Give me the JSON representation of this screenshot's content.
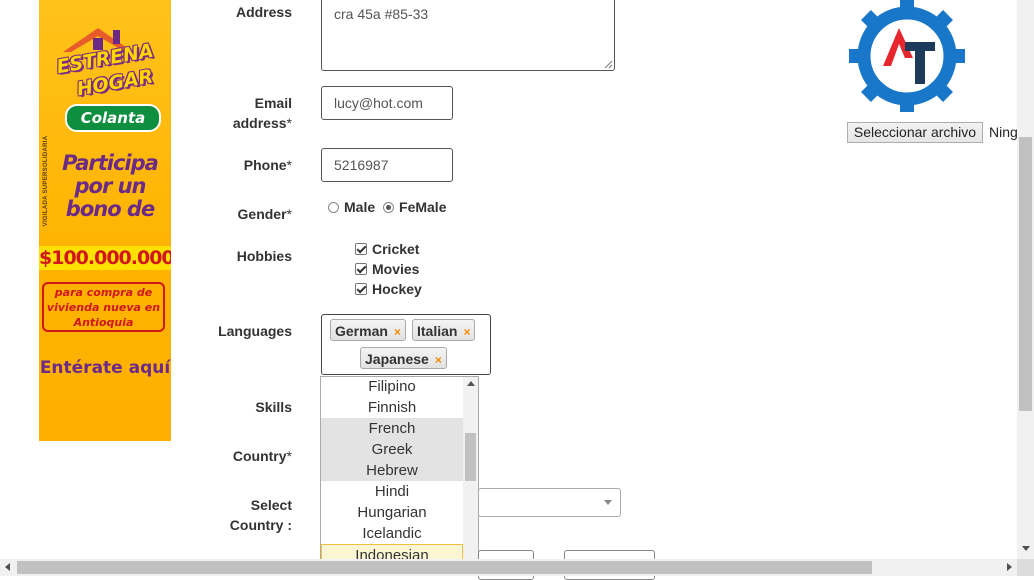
{
  "ad": {
    "brand_line1": "ESTRENA",
    "brand_line2": "HOGAR",
    "brand_logo": "Colanta",
    "side_text": "VIGILADA SUPERSOLIDARIA",
    "headline": "Participa por un bono de",
    "amount": "$100.000.000",
    "detail": "para compra de vivienda nueva en Antioquia",
    "cta": "Entérate aquí",
    "colors": {
      "background": "#ffb300",
      "purple": "#6b2a86",
      "red": "#d1161c",
      "green": "#0d8f3f"
    }
  },
  "form": {
    "address": {
      "label": "Address",
      "value": "cra 45a #85-33"
    },
    "email": {
      "label": "Email address",
      "required_mark": "*",
      "value": "lucy@hot.com"
    },
    "phone": {
      "label": "Phone",
      "required_mark": "*",
      "value": "5216987"
    },
    "gender": {
      "label": "Gender",
      "required_mark": "*",
      "options": [
        {
          "label": "Male",
          "checked": false
        },
        {
          "label": "FeMale",
          "checked": true
        }
      ]
    },
    "hobbies": {
      "label": "Hobbies",
      "items": [
        {
          "label": "Cricket",
          "checked": true
        },
        {
          "label": "Movies",
          "checked": true
        },
        {
          "label": "Hockey",
          "checked": true
        }
      ]
    },
    "languages": {
      "label": "Languages",
      "selected": [
        "German",
        "Italian",
        "Japanese"
      ],
      "remove_glyph": "×",
      "dropdown_options": [
        "Filipino",
        "Finnish",
        "French",
        "Greek",
        "Hebrew",
        "Hindi",
        "Hungarian",
        "Icelandic",
        "Indonesian"
      ],
      "highlighted_option": "Indonesian",
      "selected_options": [
        "French",
        "Greek",
        "Hebrew"
      ]
    },
    "skills": {
      "label": "Skills"
    },
    "country": {
      "label": "Country",
      "required_mark": "*"
    },
    "select_country": {
      "label": "Select Country :"
    }
  },
  "file_upload": {
    "button_label": "Seleccionar archivo",
    "status_text": "Ning"
  },
  "logo": {
    "icon": "gear-logo-icon",
    "colors": {
      "gear": "#1877c9",
      "a": "#e8262e",
      "t": "#1d3a5a"
    }
  }
}
